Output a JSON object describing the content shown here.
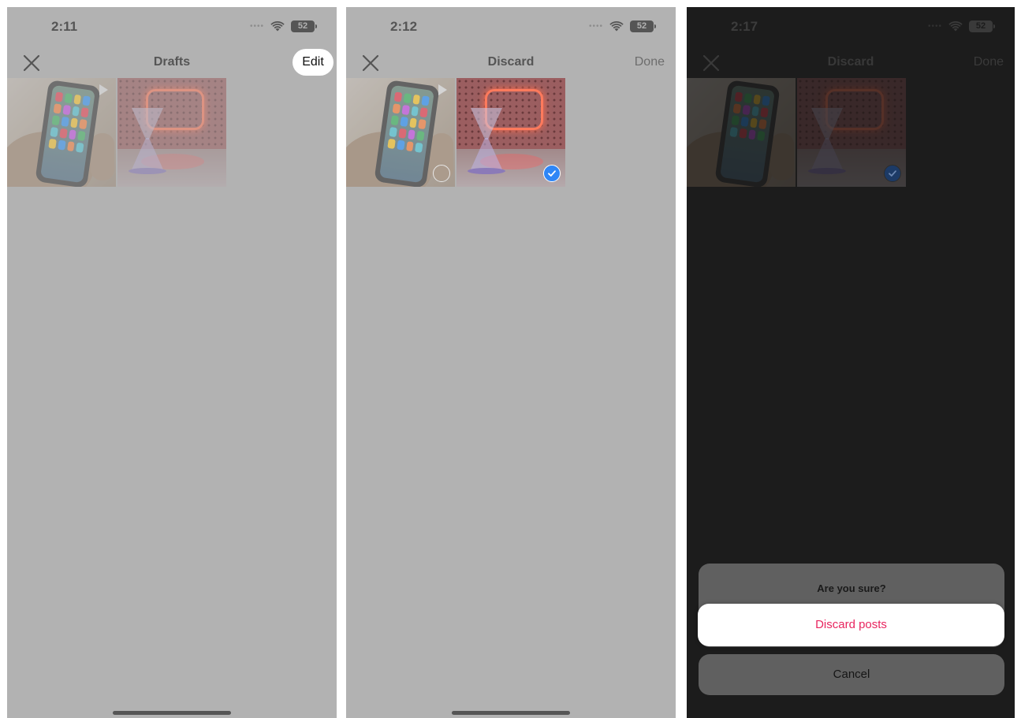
{
  "screens": [
    {
      "status_time": "2:11",
      "battery": "52",
      "nav_title": "Drafts",
      "nav_right": "Edit"
    },
    {
      "status_time": "2:12",
      "battery": "52",
      "nav_title": "Discard",
      "nav_right": "Done"
    },
    {
      "status_time": "2:17",
      "battery": "52",
      "nav_title": "Discard",
      "nav_right": "Done",
      "action_sheet": {
        "title": "Are you sure?",
        "destructive_label": "Discard posts",
        "cancel_label": "Cancel"
      }
    }
  ],
  "colors": {
    "screen_bg": "#b2b2b2",
    "dimmed_bg": "#1c1c1c",
    "accent_check": "#2f86f6",
    "destructive": "#e8255f"
  },
  "icons": [
    "close-icon",
    "wifi-icon",
    "battery-icon",
    "checkmark-icon",
    "play-icon"
  ]
}
